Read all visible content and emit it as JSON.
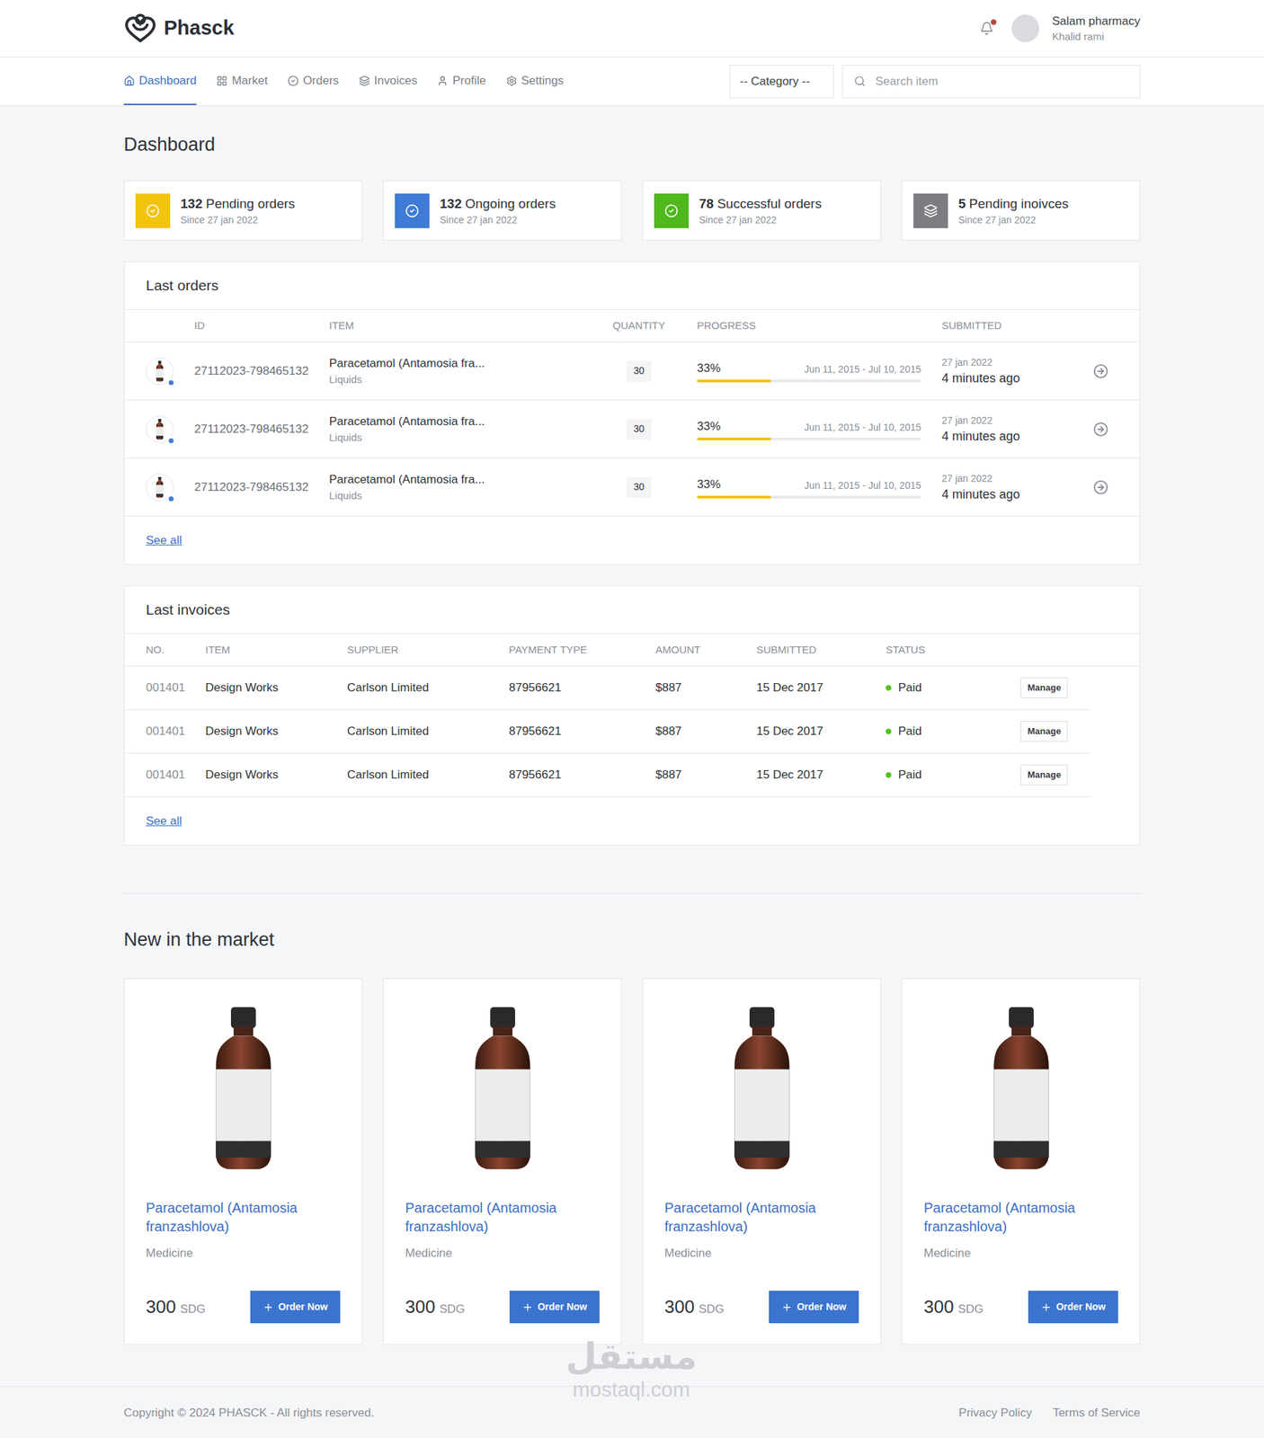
{
  "header": {
    "logo": "Phasck",
    "notification": true,
    "user": {
      "name": "Salam pharmacy",
      "sub": "Khalid rami"
    }
  },
  "nav": [
    {
      "label": "Dashboard",
      "selected": true
    },
    {
      "label": "Market",
      "selected": false
    },
    {
      "label": "Orders",
      "selected": false
    },
    {
      "label": "Invoices",
      "selected": false
    },
    {
      "label": "Profile",
      "selected": false
    },
    {
      "label": "Settings",
      "selected": false
    }
  ],
  "category": {
    "placeholder": "-- Category --"
  },
  "search": {
    "placeholder": "Search item"
  },
  "page_title": "Dashboard",
  "stats": [
    {
      "count": "132",
      "label": "Pending orders",
      "since": "Since 27 jan 2022",
      "color": "#f2c40c"
    },
    {
      "count": "132",
      "label": "Ongoing orders",
      "since": "Since 27 jan 2022",
      "color": "#3f7bd6"
    },
    {
      "count": "78",
      "label": "Successful orders",
      "since": "Since 27 jan 2022",
      "color": "#4fb81c"
    },
    {
      "count": "5",
      "label": "Pending inoivces",
      "since": "Since 27 jan 2022",
      "color": "#7b7d80"
    }
  ],
  "orders": {
    "title": "Last orders",
    "columns": [
      "ID",
      "ITEM",
      "QUANTITY",
      "PROGRESS",
      "SUBMITTED"
    ],
    "rows": [
      {
        "id": "27112023-798465132",
        "item": "Paracetamol (Antamosia fra...",
        "type": "Liquids",
        "quantity": "30",
        "reading": "33%",
        "level": 0.33,
        "dates": "Jun 11, 2015 - Jul 10, 2015",
        "date": "27 jan 2022",
        "ago": "4 minutes ago"
      },
      {
        "id": "27112023-798465132",
        "item": "Paracetamol (Antamosia fra...",
        "type": "Liquids",
        "quantity": "30",
        "reading": "33%",
        "level": 0.33,
        "dates": "Jun 11, 2015 - Jul 10, 2015",
        "date": "27 jan 2022",
        "ago": "4 minutes ago"
      },
      {
        "id": "27112023-798465132",
        "item": "Paracetamol (Antamosia fra...",
        "type": "Liquids",
        "quantity": "30",
        "reading": "33%",
        "level": 0.33,
        "dates": "Jun 11, 2015 - Jul 10, 2015",
        "date": "27 jan 2022",
        "ago": "4 minutes ago"
      }
    ],
    "see_all": "See all"
  },
  "invoices": {
    "title": "Last invoices",
    "columns": [
      "NO.",
      "ITEM",
      "SUPPLIER",
      "PAYMENT TYPE",
      "AMOUNT",
      "SUBMITTED",
      "STATUS"
    ],
    "rows": [
      {
        "no": "001401",
        "item": "Design Works",
        "supplier": "Carlson Limited",
        "payment": "87956621",
        "amount": "$887",
        "submitted": "15 Dec 2017",
        "status": "Paid",
        "color": "#52c41a",
        "action": "Manage"
      },
      {
        "no": "001401",
        "item": "Design Works",
        "supplier": "Carlson Limited",
        "payment": "87956621",
        "amount": "$887",
        "submitted": "15 Dec 2017",
        "status": "Paid",
        "color": "#52c41a",
        "action": "Manage"
      },
      {
        "no": "001401",
        "item": "Design Works",
        "supplier": "Carlson Limited",
        "payment": "87956621",
        "amount": "$887",
        "submitted": "15 Dec 2017",
        "status": "Paid",
        "color": "#52c41a",
        "action": "Manage"
      }
    ],
    "see_all": "See all"
  },
  "market": {
    "title": "New in the market",
    "products": [
      {
        "name": "Paracetamol (Antamosia franzashlova)",
        "category": "Medicine",
        "price": "300",
        "currency": "SDG",
        "button": "Order Now"
      },
      {
        "name": "Paracetamol (Antamosia franzashlova)",
        "category": "Medicine",
        "price": "300",
        "currency": "SDG",
        "button": "Order Now"
      },
      {
        "name": "Paracetamol (Antamosia franzashlova)",
        "category": "Medicine",
        "price": "300",
        "currency": "SDG",
        "button": "Order Now"
      },
      {
        "name": "Paracetamol (Antamosia franzashlova)",
        "category": "Medicine",
        "price": "300",
        "currency": "SDG",
        "button": "Order Now"
      }
    ]
  },
  "footer": {
    "copyright": "Copyright © 2024 PHASCK - All rights reserved.",
    "links": [
      "Privacy Policy",
      "Terms of Service"
    ]
  },
  "watermark": {
    "arabic": "مستقل",
    "latin": "mostaql.com"
  }
}
